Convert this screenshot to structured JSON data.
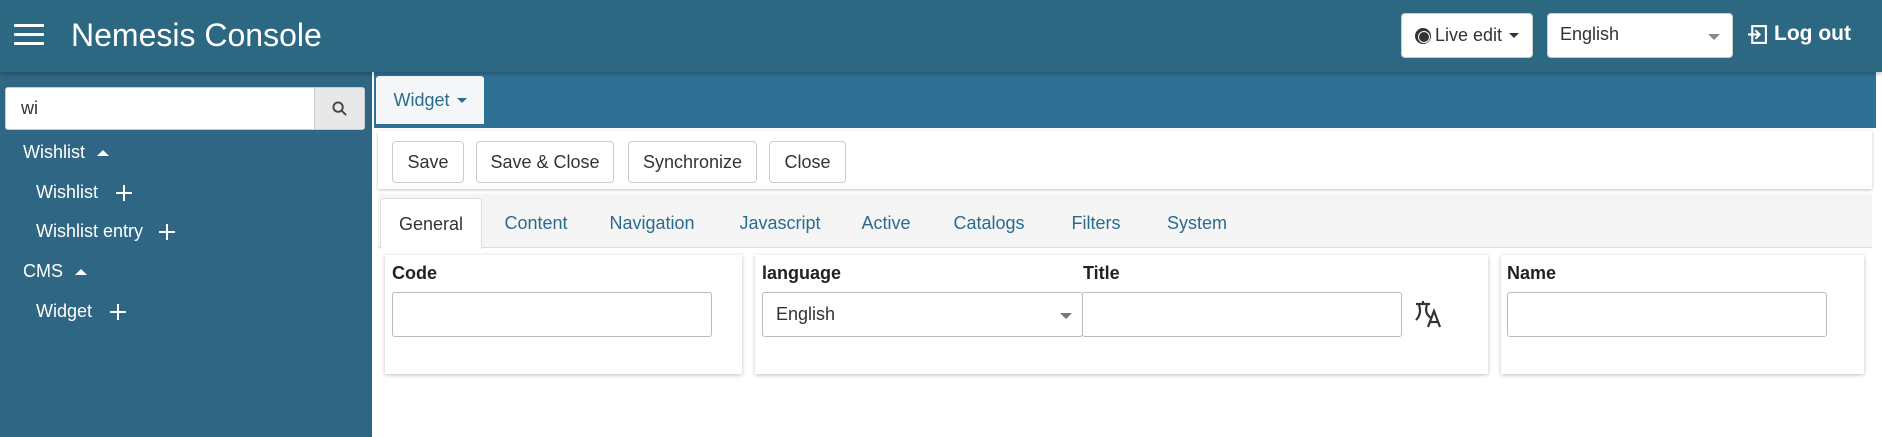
{
  "header": {
    "title": "Nemesis Console",
    "live_edit": "Live edit",
    "language": "English",
    "logout": "Log out"
  },
  "sidebar": {
    "search": {
      "value": "wi"
    },
    "items": [
      {
        "label": "Wishlist"
      },
      {
        "label": "Wishlist"
      },
      {
        "label": "Wishlist entry"
      },
      {
        "label": "CMS"
      },
      {
        "label": "Widget"
      }
    ]
  },
  "entity_tab": {
    "label": "Widget"
  },
  "toolbar": {
    "save": "Save",
    "save_close": "Save & Close",
    "synchronize": "Synchronize",
    "close": "Close"
  },
  "tabs": [
    "General",
    "Content",
    "Navigation",
    "Javascript",
    "Active",
    "Catalogs",
    "Filters",
    "System"
  ],
  "form": {
    "code_label": "Code",
    "language_label": "language",
    "language_value": "English",
    "title_label": "Title",
    "name_label": "Name"
  },
  "colors": {
    "header_bg": "#2d6883",
    "sidebar_bg": "#2f6683",
    "band_bg": "#2e7194",
    "link": "#2a6b8e"
  }
}
